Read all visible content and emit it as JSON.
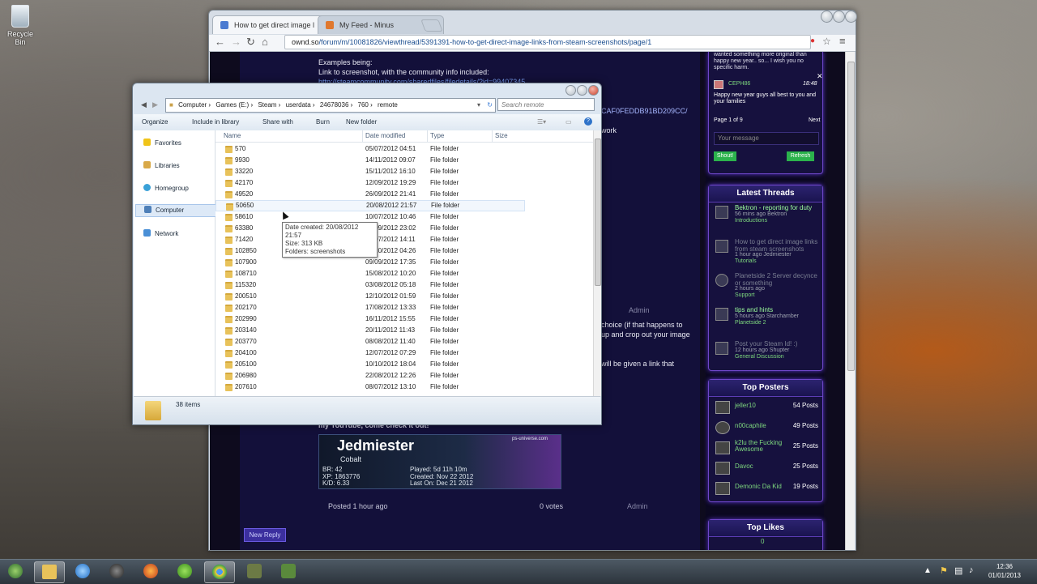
{
  "desktop": {
    "recycle_bin": "Recycle Bin"
  },
  "browser": {
    "tabs": [
      {
        "title": "How to get direct image l",
        "active": true
      },
      {
        "title": "My Feed - Minus",
        "active": false
      }
    ],
    "url_host": "ownd.so",
    "url_path": "/forum/m/10081826/viewthread/5391391-how-to-get-direct-image-links-from-steam-screenshots/page/1"
  },
  "post": {
    "examples_label": "Examples being:",
    "link_label": "Link to screenshot, with the community info included:",
    "steam_link": "http://steamcommunity.com/sharedfiles/filedetails/?id=99407345",
    "hash_fragment": "CAF0FEDDB91BD209CC/",
    "work_fragment": "work",
    "choice_line1": "choice (if that happens to",
    "choice_line2": "up and crop out your image",
    "given_link": "will be given a link that",
    "admin": "Admin",
    "youtube_line": "my YouTube, come check it out!",
    "sig": {
      "name": "Jedmiester",
      "rank": "Cobalt",
      "br": "BR: 42",
      "xp": "XP: 1863776",
      "kd": "K/D: 6.33",
      "played": "Played: 5d 11h 10m",
      "created": "Created: Nov 22 2012",
      "last_on": "Last On: Dec 21 2012",
      "site": "ps-universe.com"
    },
    "posted": "Posted 1 hour ago",
    "votes": "0 votes",
    "admin2": "Admin",
    "new_reply": "New Reply"
  },
  "sidebar": {
    "chat_top_text": "wanted something more original than happy new year.. so... I wish you no specific harm.",
    "chat_user": "CEPH86",
    "chat_time": "18:48",
    "chat_msg": "Happy new year guys all best to you and your families",
    "page_label": "Page 1 of 9",
    "next_label": "Next",
    "message_placeholder": "Your message",
    "shout_label": "Shout!",
    "refresh_label": "Refresh",
    "latest_threads_title": "Latest Threads",
    "threads": [
      {
        "title": "Bektron - reporting for duty",
        "meta": "56 mins ago Bektron",
        "category": "Introductions"
      },
      {
        "title": "How to get direct image links from steam screenshots",
        "meta": "1 hour ago Jedmiester",
        "category": "Tutorials"
      },
      {
        "title": "Planetside 2 Server decynce or something",
        "meta": "2 hours ago",
        "category": "Support"
      },
      {
        "title": "tips and hints",
        "meta": "5 hours ago Starchamber",
        "category": "Planetside 2"
      },
      {
        "title": "Post your Steam Id! :)",
        "meta": "12 hours ago Shupter",
        "category": "General Discussion"
      }
    ],
    "top_posters_title": "Top Posters",
    "posters": [
      {
        "name": "jeller10",
        "posts": "54 Posts"
      },
      {
        "name": "n00caphile",
        "posts": "49 Posts"
      },
      {
        "name": "k2lu the Fucking Awesome",
        "posts": "25 Posts"
      },
      {
        "name": "Davoc",
        "posts": "25 Posts"
      },
      {
        "name": "Demonic Da Kid",
        "posts": "19 Posts"
      }
    ],
    "top_likes_title": "Top Likes",
    "likes_count": "0"
  },
  "explorer": {
    "breadcrumbs": [
      "Computer",
      "Games (E:)",
      "Steam",
      "userdata",
      "24678036",
      "760",
      "remote"
    ],
    "search_placeholder": "Search remote",
    "commands": [
      "Organize",
      "Include in library",
      "Share with",
      "Burn",
      "New folder"
    ],
    "nav": [
      "Favorites",
      "Libraries",
      "Homegroup",
      "Computer",
      "Network"
    ],
    "columns": [
      "Name",
      "Date modified",
      "Type",
      "Size"
    ],
    "rows": [
      [
        "570",
        "05/07/2012 04:51",
        "File folder"
      ],
      [
        "9930",
        "14/11/2012 09:07",
        "File folder"
      ],
      [
        "33220",
        "15/11/2012 16:10",
        "File folder"
      ],
      [
        "42170",
        "12/09/2012 19:29",
        "File folder"
      ],
      [
        "49520",
        "26/09/2012 21:41",
        "File folder"
      ],
      [
        "50650",
        "20/08/2012 21:57",
        "File folder"
      ],
      [
        "58610",
        "10/07/2012 10:46",
        "File folder"
      ],
      [
        "63380",
        "10/09/2012 23:02",
        "File folder"
      ],
      [
        "71420",
        "10/07/2012 14:11",
        "File folder"
      ],
      [
        "102850",
        "29/10/2012 04:26",
        "File folder"
      ],
      [
        "107900",
        "09/09/2012 17:35",
        "File folder"
      ],
      [
        "108710",
        "15/08/2012 10:20",
        "File folder"
      ],
      [
        "115320",
        "03/08/2012 05:18",
        "File folder"
      ],
      [
        "200510",
        "12/10/2012 01:59",
        "File folder"
      ],
      [
        "202170",
        "17/08/2012 13:33",
        "File folder"
      ],
      [
        "202990",
        "16/11/2012 15:55",
        "File folder"
      ],
      [
        "203140",
        "20/11/2012 11:43",
        "File folder"
      ],
      [
        "203770",
        "08/08/2012 11:40",
        "File folder"
      ],
      [
        "204100",
        "12/07/2012 07:29",
        "File folder"
      ],
      [
        "205100",
        "10/10/2012 18:04",
        "File folder"
      ],
      [
        "206980",
        "22/08/2012 12:26",
        "File folder"
      ],
      [
        "207610",
        "08/07/2012 13:10",
        "File folder"
      ]
    ],
    "tooltip": {
      "line1": "Date created: 20/08/2012 21:57",
      "line2": "Size: 313 KB",
      "line3": "Folders: screenshots"
    },
    "status": "38 items"
  },
  "taskbar": {
    "time": "12:36",
    "date": "01/01/2013"
  }
}
